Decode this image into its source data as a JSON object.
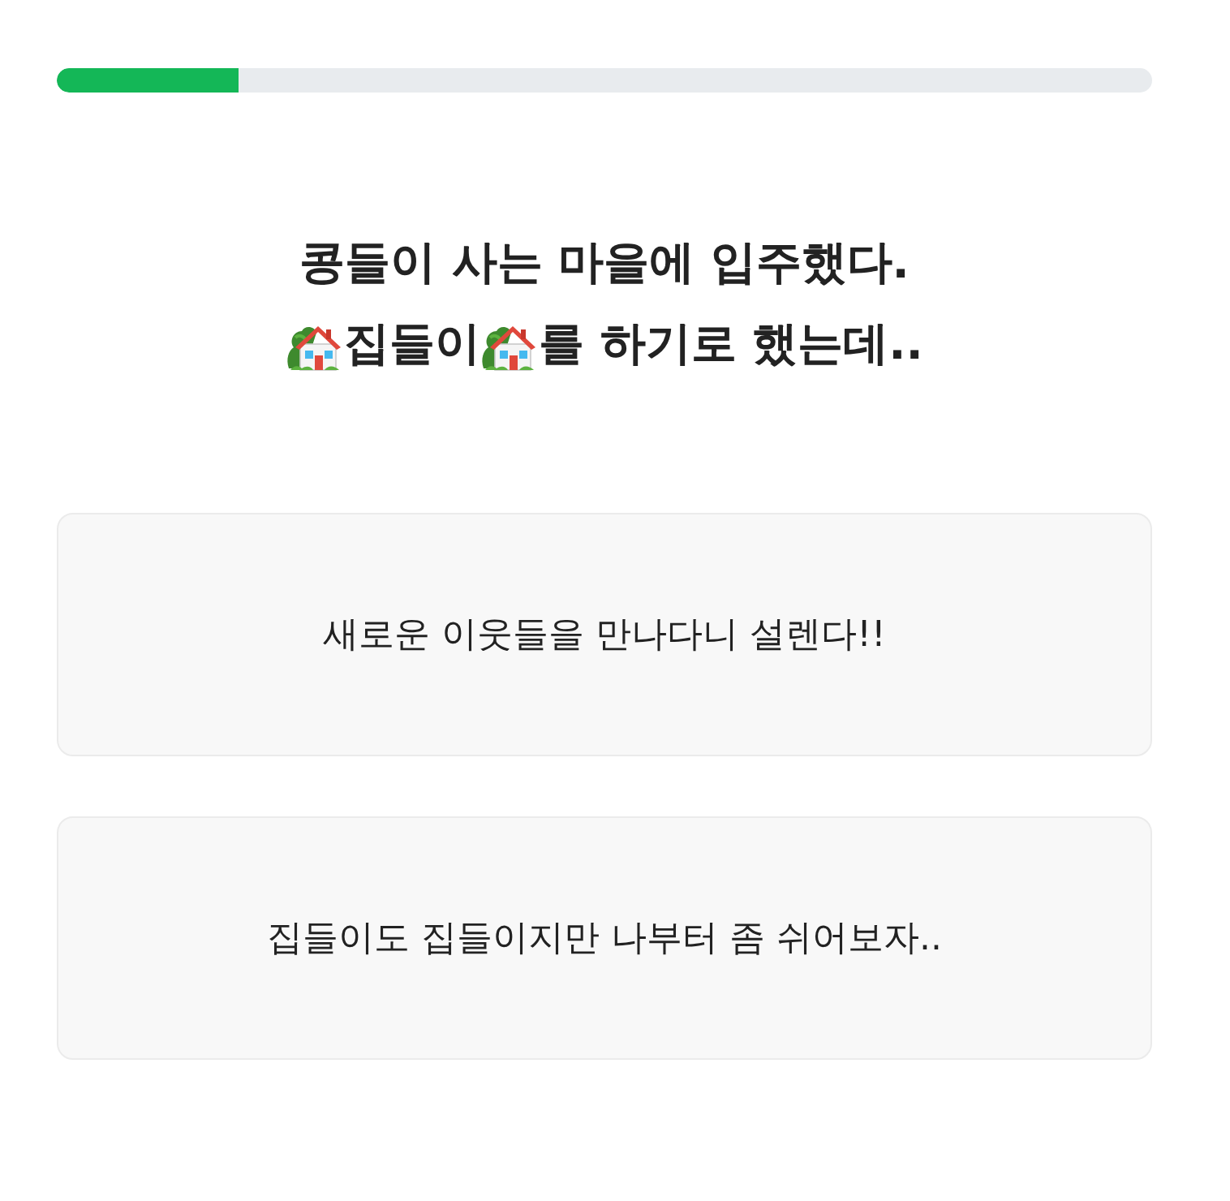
{
  "progress": {
    "level": 0.166
  },
  "question": {
    "lines": [
      [
        {
          "kind": "text",
          "text": "콩들이 사는 마을에 입주했다."
        }
      ],
      [
        {
          "kind": "house"
        },
        {
          "kind": "text",
          "text": "집들이"
        },
        {
          "kind": "house"
        },
        {
          "kind": "text",
          "text": "를 하기로 했는데.."
        }
      ]
    ]
  },
  "options": [
    {
      "text": "새로운 이웃들을 만나다니 설렌다!!",
      "selected": false
    },
    {
      "text": "집들이도 집들이지만 나부터 좀 쉬어보자..",
      "selected": false
    }
  ]
}
